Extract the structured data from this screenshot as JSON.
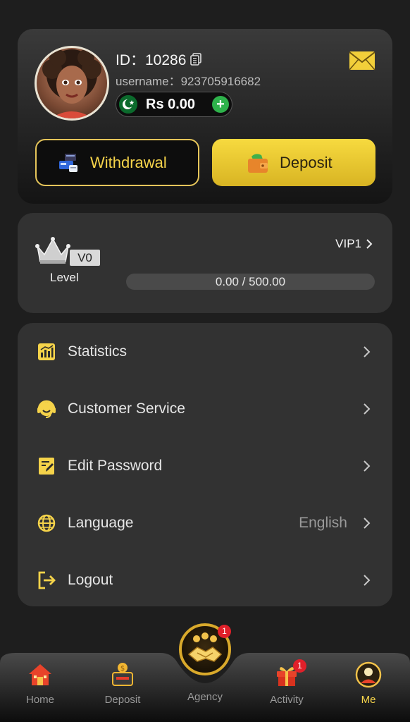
{
  "profile": {
    "id_text": "ID：10286",
    "username_text": "username：923705916682",
    "balance": "Rs 0.00"
  },
  "actions": {
    "withdrawal_label": "Withdrawal",
    "deposit_label": "Deposit"
  },
  "vip": {
    "current_level": "V0",
    "level_label": "Level",
    "next_level": "VIP1",
    "progress_text": "0.00 / 500.00",
    "progress_fraction": 0
  },
  "menu": {
    "items": [
      {
        "label": "Statistics",
        "icon": "statistics-icon"
      },
      {
        "label": "Customer Service",
        "icon": "headset-icon"
      },
      {
        "label": "Edit Password",
        "icon": "edit-password-icon"
      },
      {
        "label": "Language",
        "icon": "globe-icon",
        "value": "English"
      },
      {
        "label": "Logout",
        "icon": "logout-icon"
      }
    ]
  },
  "nav": {
    "items": [
      {
        "label": "Home",
        "icon": "home-icon"
      },
      {
        "label": "Deposit",
        "icon": "deposit-icon"
      },
      {
        "label": "Agency",
        "icon": "handshake-icon",
        "badge": "1"
      },
      {
        "label": "Activity",
        "icon": "gift-icon",
        "badge": "1"
      },
      {
        "label": "Me",
        "icon": "profile-icon",
        "active": true
      }
    ]
  },
  "colors": {
    "accent": "#f5d34a",
    "background": "#1e1e1e",
    "card": "#323232",
    "badge": "#e0202a"
  }
}
